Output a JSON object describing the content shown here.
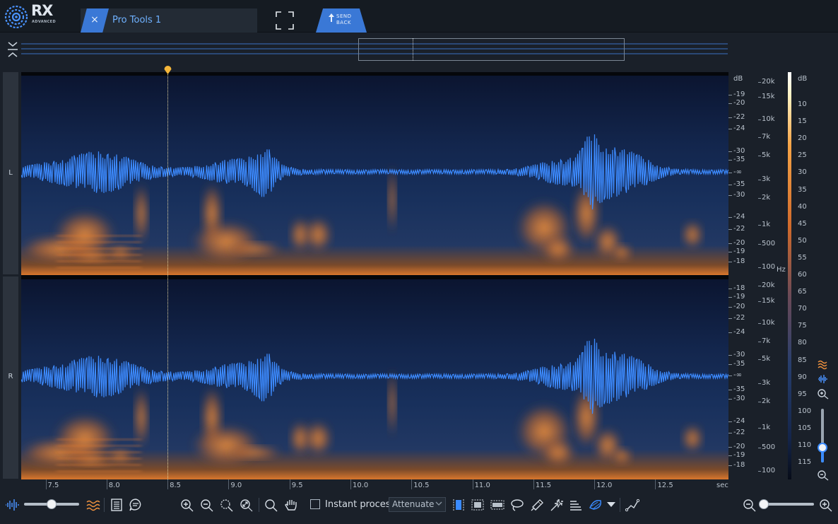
{
  "app": {
    "logo_text": "RX",
    "logo_sub": "ADVANCED"
  },
  "tab": {
    "title": "Pro Tools 1",
    "close_glyph": "×"
  },
  "send_back": {
    "label_line1": "SEND",
    "label_line2": "BACK"
  },
  "channels": [
    {
      "label": "L"
    },
    {
      "label": "R"
    }
  ],
  "playhead_time_sec": 8.5,
  "view_range_sec": [
    7.3,
    13.1
  ],
  "db_unit": "dB",
  "hz_unit": "Hz",
  "db_scale_top": [
    "-19",
    "-20",
    "-22",
    "-24",
    "-30",
    "-35",
    "-∞",
    "-35",
    "-30",
    "-24",
    "-22",
    "-20",
    "-19",
    "-18"
  ],
  "db_scale_bottom": [
    "-18",
    "-19",
    "-20",
    "-22",
    "-24",
    "-30",
    "-35",
    "-∞",
    "-35",
    "-30",
    "-24",
    "-22",
    "-20",
    "-19",
    "-18"
  ],
  "hz_scale_top": [
    "20k",
    "15k",
    "10k",
    "7k",
    "5k",
    "3k",
    "2k",
    "1k",
    "500",
    "100"
  ],
  "hz_scale_bottom": [
    "20k",
    "15k",
    "10k",
    "7k",
    "5k",
    "3k",
    "2k",
    "1k",
    "500",
    "100"
  ],
  "colorbar_scale": [
    "10",
    "15",
    "20",
    "25",
    "30",
    "35",
    "40",
    "45",
    "50",
    "55",
    "60",
    "65",
    "70",
    "75",
    "80",
    "85",
    "90",
    "95",
    "100",
    "105",
    "110",
    "115"
  ],
  "time_ticks": [
    "7.5",
    "8.0",
    "8.5",
    "9.0",
    "9.5",
    "10.0",
    "10.5",
    "11.0",
    "11.5",
    "12.0",
    "12.5"
  ],
  "time_unit": "sec",
  "toolbar": {
    "instant_process_label": "Instant process",
    "instant_process_checked": false,
    "mode_value": "Attenuate"
  },
  "icons": {
    "waveform": "waveform-icon",
    "spectrogram": "spectrogram-icon",
    "markers": "markers-icon",
    "comment": "comment-icon",
    "zoom_in": "zoom-in-icon",
    "zoom_out": "zoom-out-icon",
    "zoom_selection": "zoom-selection-icon",
    "zoom_fit": "zoom-fit-icon",
    "magnify": "magnify-icon",
    "hand": "hand-icon",
    "time_select": "time-select-icon",
    "time_freq_select": "time-frequency-select-icon",
    "freq_select": "frequency-select-icon",
    "lasso": "lasso-icon",
    "brush": "brush-icon",
    "magic_wand": "magic-wand-icon",
    "harmonic": "harmonic-select-icon",
    "gain": "gain-icon",
    "curve": "curve-icon"
  },
  "colors": {
    "accent": "#3a78d6",
    "waveform": "#3d8bff",
    "spectrum_hot": "#e8843a"
  }
}
